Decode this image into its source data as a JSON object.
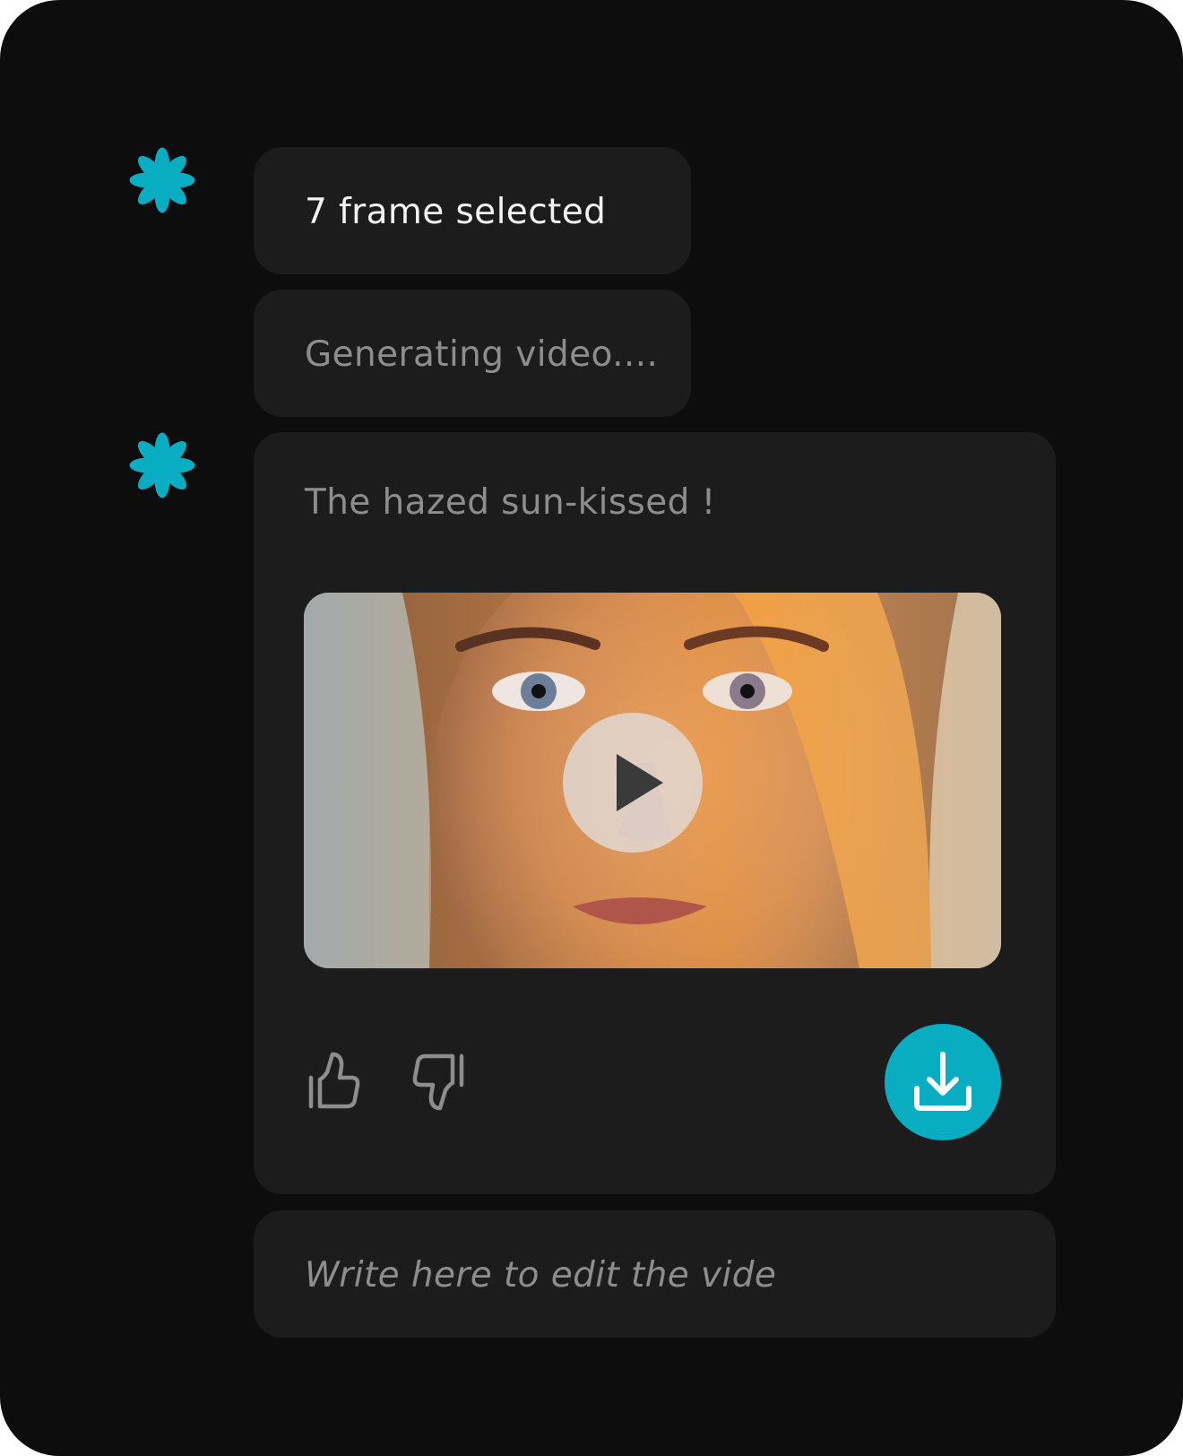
{
  "theme": {
    "accent": "#09adc2",
    "panel": "#1c1c1c",
    "background": "#0d0d0d"
  },
  "assistant_icon": "asterisk-icon",
  "messages": [
    {
      "text": "7 frame selected"
    },
    {
      "text": "Generating video...."
    },
    {
      "text": "The hazed sun-kissed !"
    }
  ],
  "video": {
    "thumbnail": "portrait of a woman in warm sunlight",
    "play_icon": "play-icon"
  },
  "actions": {
    "like_icon": "thumbs-up-icon",
    "dislike_icon": "thumbs-down-icon",
    "download_icon": "download-icon"
  },
  "composer": {
    "placeholder": "Write here to edit the vide",
    "value": ""
  }
}
